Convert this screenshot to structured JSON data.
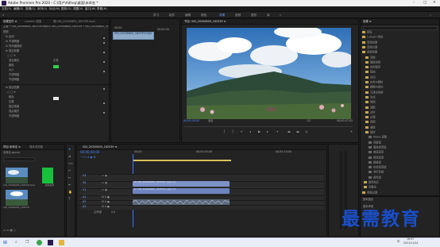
{
  "titlebar": {
    "title": "Adobe Premiere Pro 2020 - C:\\用户\\Adhop\\桌面\\未命名 *"
  },
  "menu": [
    "文件(F)",
    "编辑(E)",
    "剪辑(C)",
    "序列(S)",
    "标记(M)",
    "图形(G)",
    "视图(V)",
    "窗口(W)",
    "帮助(H)"
  ],
  "workspaces": [
    "学习",
    "组件",
    "编辑",
    "颜色",
    "效果",
    "音频",
    "图形",
    "库",
    "»"
  ],
  "workspace_active": "效果",
  "effect_controls": {
    "tabs": [
      "效果控件 ≡",
      "Lumetri 范围",
      "源:VID_20200605_162539.mp4",
      "音频剪辑混合器:VID_20200605_162539"
    ],
    "source_line": "主要 * VID_20200605_162539.mp4  ▸  VID_20200605_162539 * VID_20200605_162539.mp4",
    "section": "视频",
    "rows": [
      "fx 运动",
      "fx 不透明度",
      "fx 时间重映射",
      "fx 描边效果",
      "",
      "混合模式",
      "颜色",
      "大小",
      "不透明度",
      "不透明度",
      "",
      "fx 描边效果",
      "",
      "颜色",
      "位置",
      "描边宽度",
      "混合模式",
      "不透明度"
    ],
    "blend_value": "正常",
    "timecode": "00;00;00;00"
  },
  "source_mini": {
    "header": "00;00",
    "items": [
      "*",
      "00;00;00",
      "VID_20200605_162539.mp4"
    ]
  },
  "program": {
    "tab": "节目: VID_20200605_162539 ≡",
    "timecode_left": "00;00;00;00",
    "fit": "适合",
    "scale": "1/2",
    "timecode_right": "00;00;07;02"
  },
  "project": {
    "tabs": [
      "项目:未命名 ≡",
      "媒体浏览器"
    ],
    "path": "未命名.prproj",
    "search_placeholder": "",
    "items": [
      {
        "name": "VID_20200605_162539.mp4",
        "duration": "7;02"
      },
      {
        "name": "颜色遮罩",
        "duration": "4;28"
      },
      {
        "name": "VID_20200605_162539",
        "duration": "7;02"
      }
    ]
  },
  "timeline": {
    "tab": "VID_20200605_162539 ≡",
    "timecode": "00;00;00;00",
    "ruler": [
      "00;00",
      "00;00;05;00",
      "00;00;10;00"
    ],
    "tracks": [
      "V3",
      "V2",
      "V1",
      "A1",
      "A2",
      "A3"
    ],
    "master": "主声道",
    "master_value": "0.0",
    "clips": [
      {
        "label": "fx VID_20200605_162539.mp4 [V]",
        "track": "V2"
      },
      {
        "label": "fx VID_20200605_162539.mp4 [V]",
        "track": "V1"
      }
    ]
  },
  "effects": {
    "tab": "效果 ≡",
    "items": [
      "预设",
      "Lumetri 预设",
      "音频效果",
      "音频过渡",
      "视频效果",
      "变换",
      "图像控制",
      "实用程序",
      "扭曲",
      "时间",
      "杂色与颗粒",
      "模糊与锐化",
      "沉浸式视频",
      "生成",
      "视频",
      "调整",
      "过时",
      "过渡",
      "透视",
      "通道",
      "键控",
      "Alpha 调整",
      "亮度键",
      "图像遮罩键",
      "差值遮罩",
      "移除遮罩",
      "超级键",
      "轨道遮罩键",
      "非红色键",
      "颜色键",
      "颜色校正",
      "风格化",
      "视频过渡"
    ],
    "bottom": [
      "基本图形",
      "基本声音",
      "Lumetri 颜色"
    ]
  },
  "taskbar": {
    "time": "16:07",
    "date": "2021/11/24",
    "lang": "中"
  },
  "watermark": "最需教育"
}
